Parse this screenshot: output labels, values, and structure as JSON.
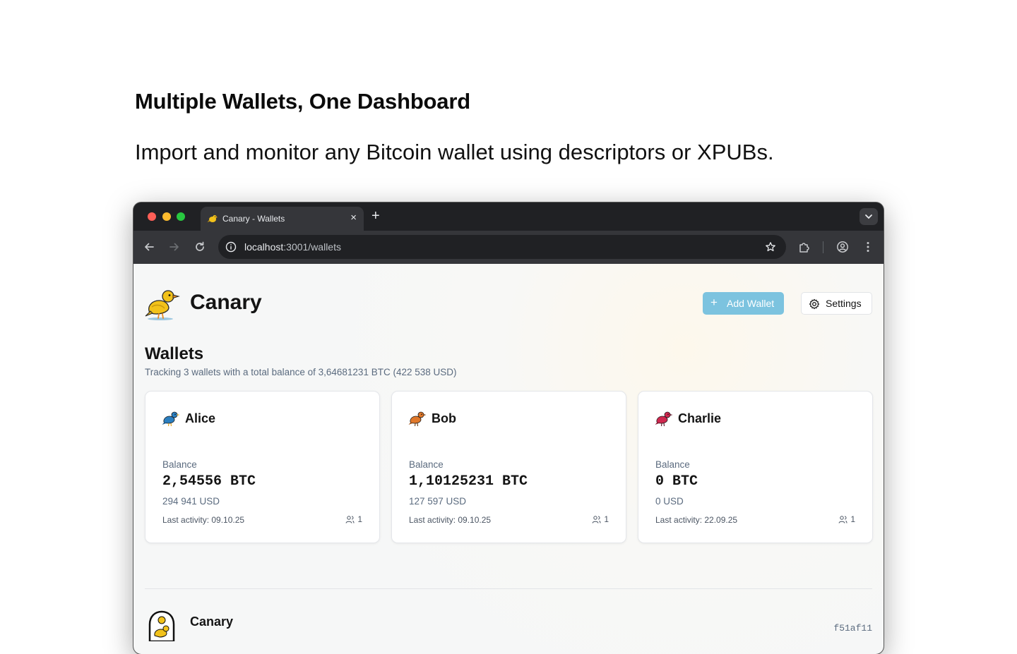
{
  "hero": {
    "title": "Multiple Wallets, One Dashboard",
    "subtitle": "Import and monitor any Bitcoin wallet using descriptors or XPUBs."
  },
  "browser": {
    "tab_title": "Canary - Wallets",
    "tab_close": "×",
    "new_tab": "+",
    "address_host": "localhost",
    "address_path": ":3001/wallets"
  },
  "app": {
    "name": "Canary",
    "add_wallet_label": "Add Wallet",
    "add_wallet_plus": "+",
    "settings_label": "Settings"
  },
  "wallets_section": {
    "title": "Wallets",
    "summary": "Tracking 3 wallets with a total balance of 3,64681231 BTC (422 538 USD)"
  },
  "wallets": [
    {
      "name": "Alice",
      "balance_label": "Balance",
      "balance": "2,54556 BTC",
      "usd": "294 941 USD",
      "last_activity": "Last activity: 09.10.25",
      "users": "1",
      "bird_color": "#2b7fc0"
    },
    {
      "name": "Bob",
      "balance_label": "Balance",
      "balance": "1,10125231 BTC",
      "usd": "127 597 USD",
      "last_activity": "Last activity: 09.10.25",
      "users": "1",
      "bird_color": "#e0782a"
    },
    {
      "name": "Charlie",
      "balance_label": "Balance",
      "balance": "0 BTC",
      "usd": "0 USD",
      "last_activity": "Last activity: 22.09.25",
      "users": "1",
      "bird_color": "#d0284f"
    }
  ],
  "footer": {
    "title": "Canary",
    "hash": "f51af11"
  },
  "colors": {
    "accent": "#7cc3df",
    "canary_yellow": "#f2c21b"
  }
}
